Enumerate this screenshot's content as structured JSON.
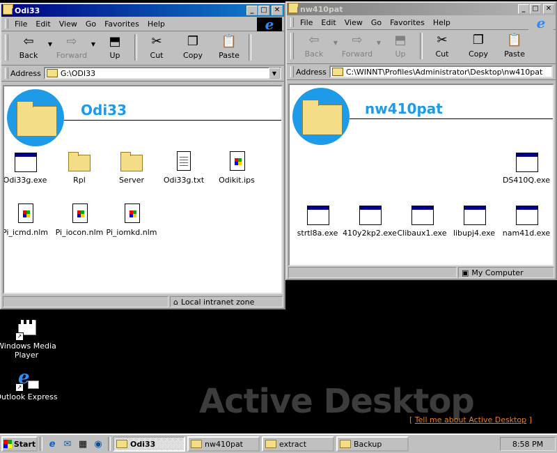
{
  "windows": [
    {
      "title": "Odi33",
      "menu": [
        "File",
        "Edit",
        "View",
        "Go",
        "Favorites",
        "Help"
      ],
      "toolbar": {
        "back": "Back",
        "forward": "Forward",
        "up": "Up",
        "cut": "Cut",
        "copy": "Copy",
        "paste": "Paste"
      },
      "address_label": "Address",
      "address": "G:\\ODI33",
      "header_title": "Odi33",
      "items": [
        "Odi33g.exe",
        "Rpl",
        "Server",
        "Odi33g.txt",
        "Odikit.ips",
        "Pi_icmd.nlm",
        "Pi_iocon.nlm",
        "Pi_iomkd.nlm"
      ],
      "status": "Local intranet zone"
    },
    {
      "title": "nw410pat",
      "menu": [
        "File",
        "Edit",
        "View",
        "Go",
        "Favorites",
        "Help"
      ],
      "toolbar": {
        "back": "Back",
        "forward": "Forward",
        "up": "Up",
        "cut": "Cut",
        "copy": "Copy",
        "paste": "Paste"
      },
      "address_label": "Address",
      "address": "C:\\WINNT\\Profiles\\Administrator\\Desktop\\nw410pat",
      "header_title": "nw410pat",
      "items": [
        "DS410Q.exe",
        "strtl8a.exe",
        "410y2kp2.exe",
        "Clibaux1.exe",
        "libupj4.exe",
        "nam41d.exe"
      ],
      "status": "My Computer"
    }
  ],
  "desktop_icons": [
    {
      "label": "Windows Media Player",
      "icon": "media-player-icon"
    },
    {
      "label": "Outlook Express",
      "icon": "outlook-express-icon"
    }
  ],
  "active_desktop": {
    "watermark": "Active Desktop",
    "tell_link": "Tell me about Active Desktop",
    "bracket_open": "[",
    "bracket_close": "]"
  },
  "taskbar": {
    "start_label": "Start",
    "tasks": [
      "Odi33",
      "nw410pat",
      "extract",
      "Backup"
    ],
    "clock": "8:58 PM"
  }
}
